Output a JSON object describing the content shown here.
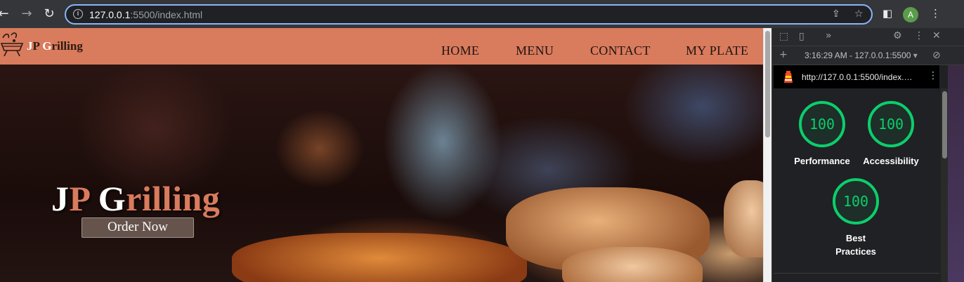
{
  "browser": {
    "back_icon": "arrow-left-icon",
    "forward_icon": "arrow-right-icon",
    "reload_icon": "reload-icon",
    "url_host": "127.0.0.1",
    "url_rest": ":5500/index.html",
    "profile_initial": "A"
  },
  "site": {
    "brand": {
      "part1": "J",
      "part2": "P ",
      "part3": "G",
      "part4": "rilling"
    },
    "nav": [
      {
        "label": "HOME"
      },
      {
        "label": "MENU"
      },
      {
        "label": "CONTACT"
      },
      {
        "label": "MY PLATE"
      }
    ],
    "hero": {
      "title_part1": "J",
      "title_part2": "P ",
      "title_part3": "G",
      "title_part4": "rilling",
      "order_button": "Order Now"
    },
    "colors": {
      "brand": "#d97b5d"
    }
  },
  "devtools": {
    "report_time": "3:16:29 AM - 127.0.0.1:5500",
    "report_url": "http://127.0.0.1:5500/index.…",
    "scores": [
      {
        "value": "100",
        "label": "Performance"
      },
      {
        "value": "100",
        "label": "Accessibility"
      },
      {
        "value": "100",
        "label_line1": "Best",
        "label_line2": "Practices"
      }
    ],
    "score_color": "#0cce6b"
  }
}
